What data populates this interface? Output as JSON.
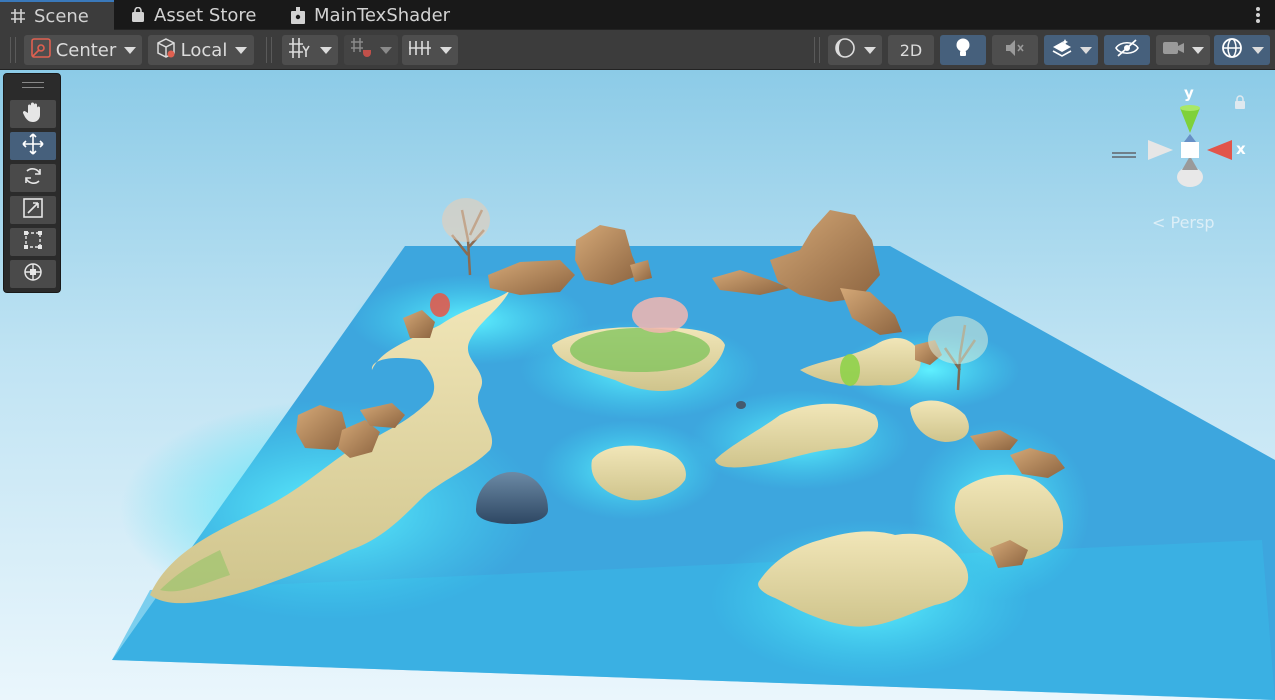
{
  "tabs": [
    {
      "label": "Scene",
      "icon": "grid-hash-icon",
      "active": true
    },
    {
      "label": "Asset Store",
      "icon": "shopping-bag-icon",
      "active": false
    },
    {
      "label": "MainTexShader",
      "icon": "shader-graph-icon",
      "active": false
    }
  ],
  "toolbar": {
    "pivot_label": "Center",
    "space_label": "Local",
    "two_d_label": "2D"
  },
  "viewport": {
    "camera_mode": "Persp",
    "gizmo_x": "x",
    "gizmo_y": "y"
  },
  "colors": {
    "sky_top": "#8fcde8",
    "sky_bottom": "#e6f5fc",
    "water_deep": "#3da3dc",
    "water_shallow": "#3ee0f2",
    "sand": "#e9dcaa",
    "rock": "#b88a5c",
    "accent_blue": "#46607c"
  }
}
